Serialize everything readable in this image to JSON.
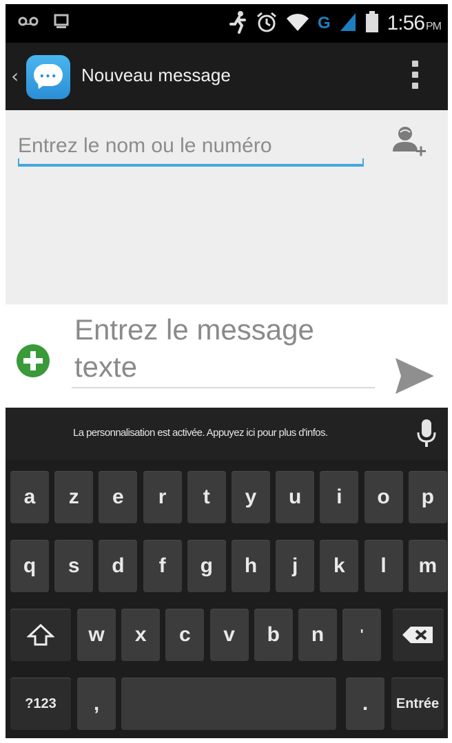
{
  "status_bar": {
    "time": "1:56",
    "ampm": "PM",
    "network": "G"
  },
  "action_bar": {
    "title": "Nouveau message"
  },
  "recipient": {
    "placeholder": "Entrez le nom ou le numéro"
  },
  "compose": {
    "placeholder": "Entrez le message texte"
  },
  "keyboard": {
    "suggestion": "La personnalisation est activée. Appuyez ici pour plus d'infos.",
    "row1": [
      "a",
      "z",
      "e",
      "r",
      "t",
      "y",
      "u",
      "i",
      "o",
      "p"
    ],
    "row2": [
      "q",
      "s",
      "d",
      "f",
      "g",
      "h",
      "j",
      "k",
      "l",
      "m"
    ],
    "row3": [
      "w",
      "x",
      "c",
      "v",
      "b",
      "n",
      "'"
    ],
    "symbols_label": "?123",
    "comma_label": ",",
    "period_label": ".",
    "enter_label": "Entrée"
  },
  "colors": {
    "accent": "#45a8df",
    "add_green": "#3a9a3a",
    "network_blue": "#1e7fc0"
  }
}
